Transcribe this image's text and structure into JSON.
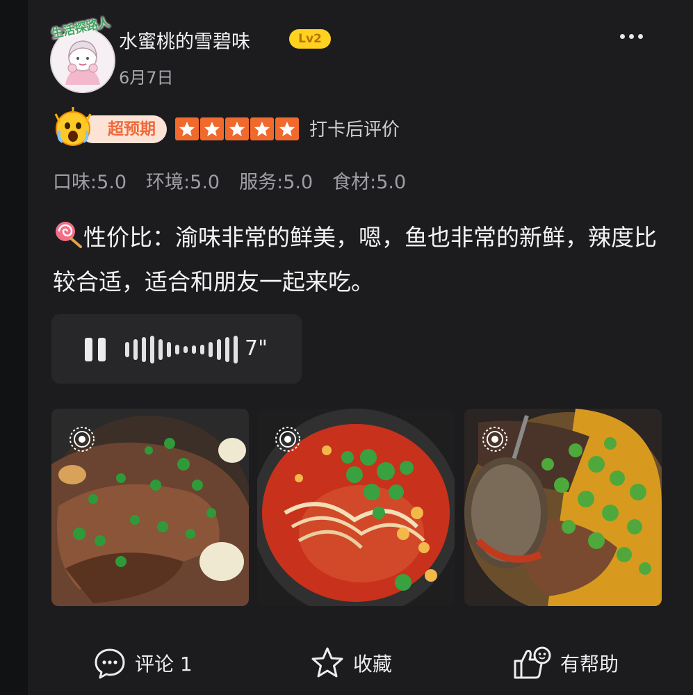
{
  "header": {
    "avatar_tag": "生活探路人",
    "username": "水蜜桃的雪碧味",
    "level": "Lv2",
    "date": "6月7日",
    "more_icon": "more-dots-icon"
  },
  "rating": {
    "badge_label": "超预期",
    "badge_icon": "surprised-face-icon",
    "stars": 5,
    "star_color": "#ef6a2c",
    "checkin_label": "打卡后评价",
    "scores": [
      "口味:5.0",
      "环境:5.0",
      "服务:5.0",
      "食材:5.0"
    ]
  },
  "review": {
    "text": "性价比：渝味非常的鲜美，嗯，鱼也非常的新鲜，辣度比较合适，适合和朋友一起来吃。",
    "leading_icon": "lollipop-icon"
  },
  "voice": {
    "duration": "7\"",
    "state_icon": "pause-icon"
  },
  "photos": [
    {
      "name": "fish-dish-photo",
      "live_icon": "live-photo-icon"
    },
    {
      "name": "noodle-soup-photo",
      "live_icon": "live-photo-icon"
    },
    {
      "name": "pepper-fish-photo",
      "live_icon": "live-photo-icon"
    }
  ],
  "actions": {
    "comment_label": "评论 1",
    "favorite_label": "收藏",
    "helpful_label": "有帮助"
  }
}
